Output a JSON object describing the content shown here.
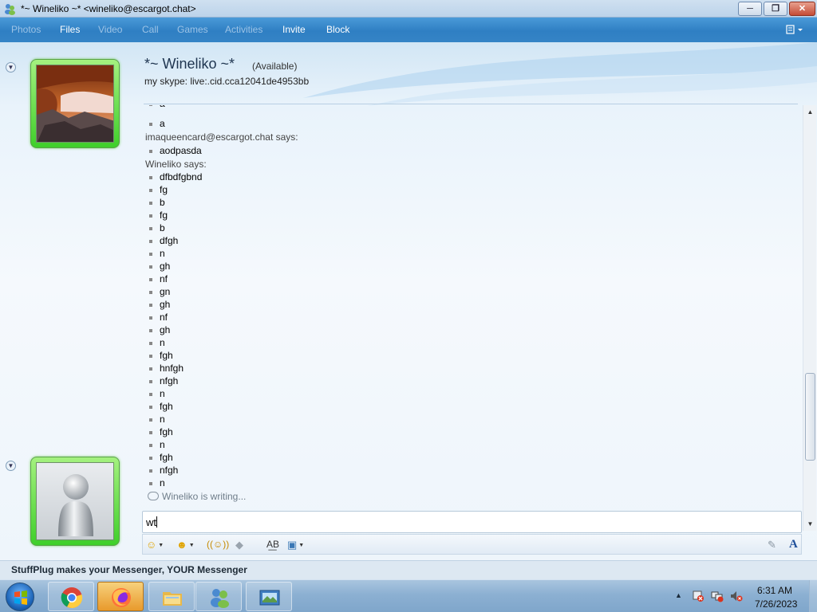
{
  "window": {
    "title": "*~ Wineliko ~* <wineliko@escargot.chat>",
    "min_label": "─",
    "max_label": "❐",
    "close_label": "✕"
  },
  "menu": {
    "items": [
      {
        "label": "Photos",
        "enabled": false
      },
      {
        "label": "Files",
        "enabled": true
      },
      {
        "label": "Video",
        "enabled": false
      },
      {
        "label": "Call",
        "enabled": false
      },
      {
        "label": "Games",
        "enabled": false
      },
      {
        "label": "Activities",
        "enabled": false
      },
      {
        "label": "Invite",
        "enabled": true
      },
      {
        "label": "Block",
        "enabled": true
      }
    ]
  },
  "contact": {
    "name": "*~ Wineliko ~*",
    "status": "(Available)",
    "personal_message": "my skype: live:.cid.cca12041de4953bb"
  },
  "conversation": {
    "lines": [
      {
        "type": "msg",
        "text": "a"
      },
      {
        "type": "msg",
        "text": "a"
      },
      {
        "type": "says",
        "text": "imaqueencard@escargot.chat says:"
      },
      {
        "type": "msg",
        "text": "aodpasda"
      },
      {
        "type": "says",
        "text": "Wineliko says:"
      },
      {
        "type": "msg",
        "text": "dfbdfgbnd"
      },
      {
        "type": "msg",
        "text": "fg"
      },
      {
        "type": "msg",
        "text": "b"
      },
      {
        "type": "msg",
        "text": "fg"
      },
      {
        "type": "msg",
        "text": "b"
      },
      {
        "type": "msg",
        "text": "dfgh"
      },
      {
        "type": "msg",
        "text": "n"
      },
      {
        "type": "msg",
        "text": "gh"
      },
      {
        "type": "msg",
        "text": "nf"
      },
      {
        "type": "msg",
        "text": "gn"
      },
      {
        "type": "msg",
        "text": "gh"
      },
      {
        "type": "msg",
        "text": "nf"
      },
      {
        "type": "msg",
        "text": "gh"
      },
      {
        "type": "msg",
        "text": "n"
      },
      {
        "type": "msg",
        "text": "fgh"
      },
      {
        "type": "msg",
        "text": "hnfgh"
      },
      {
        "type": "msg",
        "text": "nfgh"
      },
      {
        "type": "msg",
        "text": "n"
      },
      {
        "type": "msg",
        "text": "fgh"
      },
      {
        "type": "msg",
        "text": "n"
      },
      {
        "type": "msg",
        "text": "fgh"
      },
      {
        "type": "msg",
        "text": "n"
      },
      {
        "type": "msg",
        "text": "fgh"
      },
      {
        "type": "msg",
        "text": "nfgh"
      },
      {
        "type": "msg",
        "text": "n"
      }
    ],
    "typing_status": "Wineliko is writing..."
  },
  "input": {
    "value": "wt"
  },
  "toolbar": {
    "emoticon": "☺",
    "wink": "☻",
    "nudge": "((☺))",
    "voice_clip": "◆",
    "font": "A",
    "change_font": "A͟B",
    "background": "▣",
    "handwriting": "✎"
  },
  "statusbar": {
    "promo": "StuffPlug makes your Messenger, YOUR Messenger"
  },
  "taskbar": {
    "time": "6:31 AM",
    "date": "7/26/2023",
    "tray_arrow": "▲"
  },
  "colors": {
    "menu_bar": "#2f7fc3",
    "display_pic_border": "#3fcf2a",
    "close_button": "#c44c36"
  }
}
